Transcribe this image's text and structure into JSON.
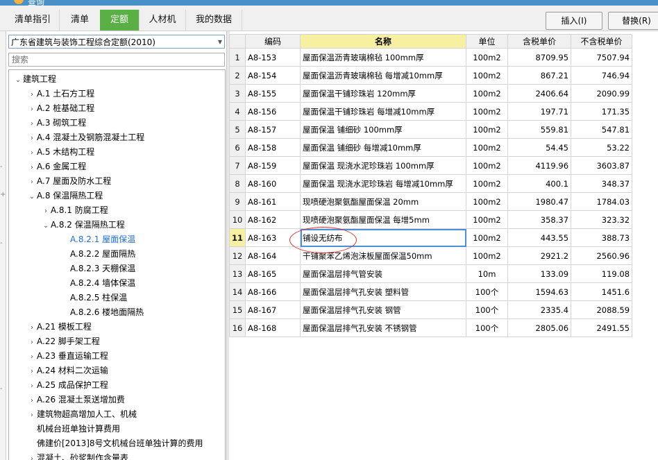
{
  "window": {
    "title": "查询"
  },
  "tabs": [
    {
      "label": "清单指引",
      "active": false
    },
    {
      "label": "清单",
      "active": false
    },
    {
      "label": "定额",
      "active": true
    },
    {
      "label": "人材机",
      "active": false
    },
    {
      "label": "我的数据",
      "active": false
    }
  ],
  "toolbar": {
    "insert_label": "插入(I)",
    "replace_label": "替换(R)"
  },
  "quota_library": {
    "selected": "广东省建筑与装饰工程综合定额(2010)"
  },
  "search": {
    "placeholder": "搜索"
  },
  "tree": [
    {
      "label": "建筑工程",
      "state": "open"
    },
    {
      "label": "A.1 土石方工程",
      "state": "closed"
    },
    {
      "label": "A.2 桩基础工程",
      "state": "closed"
    },
    {
      "label": "A.3 砌筑工程",
      "state": "closed"
    },
    {
      "label": "A.4 混凝土及钢筋混凝土工程",
      "state": "closed"
    },
    {
      "label": "A.5 木结构工程",
      "state": "closed"
    },
    {
      "label": "A.6 金属工程",
      "state": "closed"
    },
    {
      "label": "A.7 屋面及防水工程",
      "state": "closed"
    },
    {
      "label": "A.8 保温隔热工程",
      "state": "open"
    },
    {
      "label": "A.8.1 防腐工程",
      "state": "closed"
    },
    {
      "label": "A.8.2 保温隔热工程",
      "state": "open"
    },
    {
      "label": "A.8.2.1 屋面保温",
      "state": "leaf",
      "selected": true
    },
    {
      "label": "A.8.2.2 屋面隔热",
      "state": "leaf"
    },
    {
      "label": "A.8.2.3 天棚保温",
      "state": "leaf"
    },
    {
      "label": "A.8.2.4 墙体保温",
      "state": "leaf"
    },
    {
      "label": "A.8.2.5 柱保温",
      "state": "leaf"
    },
    {
      "label": "A.8.2.6 楼地面隔热",
      "state": "leaf"
    },
    {
      "label": "A.21 模板工程",
      "state": "closed"
    },
    {
      "label": "A.22 脚手架工程",
      "state": "closed"
    },
    {
      "label": "A.23 垂直运输工程",
      "state": "closed"
    },
    {
      "label": "A.24 材料二次运输",
      "state": "closed"
    },
    {
      "label": "A.25 成品保护工程",
      "state": "closed"
    },
    {
      "label": "A.26 混凝土泵送增加费",
      "state": "closed"
    },
    {
      "label": "建筑物超高增加人工、机械",
      "state": "closed"
    },
    {
      "label": "机械台班单独计算费用",
      "state": "none"
    },
    {
      "label": "佛建价[2013]8号文机械台班单独计算的费用",
      "state": "none"
    },
    {
      "label": "混凝土、砂浆制作含量表",
      "state": "closed"
    }
  ],
  "table": {
    "headers": [
      "编码",
      "名称",
      "单位",
      "含税单价",
      "不含税单价"
    ],
    "current_row": 11,
    "rows": [
      {
        "no": "1",
        "code": "A8-153",
        "name": "屋面保温沥青玻璃棉毡 100mm厚",
        "unit": "100m2",
        "price_tax": "8709.95",
        "price_notax": "7507.94"
      },
      {
        "no": "2",
        "code": "A8-154",
        "name": "屋面保温沥青玻璃棉毡 每增减10mm厚",
        "unit": "100m2",
        "price_tax": "867.21",
        "price_notax": "746.94"
      },
      {
        "no": "3",
        "code": "A8-155",
        "name": "屋面保温干铺珍珠岩 120mm厚",
        "unit": "100m2",
        "price_tax": "2406.64",
        "price_notax": "2090.99"
      },
      {
        "no": "4",
        "code": "A8-156",
        "name": "屋面保温干铺珍珠岩 每增减10mm厚",
        "unit": "100m2",
        "price_tax": "197.71",
        "price_notax": "171.35"
      },
      {
        "no": "5",
        "code": "A8-157",
        "name": "屋面保温 铺细砂 100mm厚",
        "unit": "100m2",
        "price_tax": "559.81",
        "price_notax": "547.81"
      },
      {
        "no": "6",
        "code": "A8-158",
        "name": "屋面保温 铺细砂 每增减10mm厚",
        "unit": "100m2",
        "price_tax": "54.45",
        "price_notax": "53.22"
      },
      {
        "no": "7",
        "code": "A8-159",
        "name": "屋面保温 现浇水泥珍珠岩 100mm厚",
        "unit": "100m2",
        "price_tax": "4119.96",
        "price_notax": "3603.87"
      },
      {
        "no": "8",
        "code": "A8-160",
        "name": "屋面保温 现浇水泥珍珠岩 每增减10mm厚",
        "unit": "100m2",
        "price_tax": "400.1",
        "price_notax": "348.37"
      },
      {
        "no": "9",
        "code": "A8-161",
        "name": "现喷硬泡聚氨酯屋面保温 20mm",
        "unit": "100m2",
        "price_tax": "1980.47",
        "price_notax": "1784.03"
      },
      {
        "no": "10",
        "code": "A8-162",
        "name": "现喷硬泡聚氨酯屋面保温 每增5mm",
        "unit": "100m2",
        "price_tax": "358.37",
        "price_notax": "323.32"
      },
      {
        "no": "11",
        "code": "A8-163",
        "name": "铺设无纺布",
        "unit": "100m2",
        "price_tax": "443.55",
        "price_notax": "388.73"
      },
      {
        "no": "12",
        "code": "A8-164",
        "name": "干铺聚苯乙烯泡沫板屋面保温50mm",
        "unit": "100m2",
        "price_tax": "2921.2",
        "price_notax": "2560.96"
      },
      {
        "no": "13",
        "code": "A8-165",
        "name": "屋面保温层排气管安装",
        "unit": "10m",
        "price_tax": "133.09",
        "price_notax": "119.08"
      },
      {
        "no": "14",
        "code": "A8-166",
        "name": "屋面保温层排气孔安装 塑料管",
        "unit": "100个",
        "price_tax": "1594.63",
        "price_notax": "1451.6"
      },
      {
        "no": "15",
        "code": "A8-167",
        "name": "屋面保温层排气孔安装 钢管",
        "unit": "100个",
        "price_tax": "2335.4",
        "price_notax": "2088.59"
      },
      {
        "no": "16",
        "code": "A8-168",
        "name": "屋面保温层排气孔安装 不锈钢管",
        "unit": "100个",
        "price_tax": "2805.06",
        "price_notax": "2491.55"
      }
    ]
  },
  "colors": {
    "active_tab": "#5ab044",
    "header_highlight": "#f7f0a0",
    "selected_tree": "#1e6fd9",
    "annotation": "#e0302c"
  }
}
